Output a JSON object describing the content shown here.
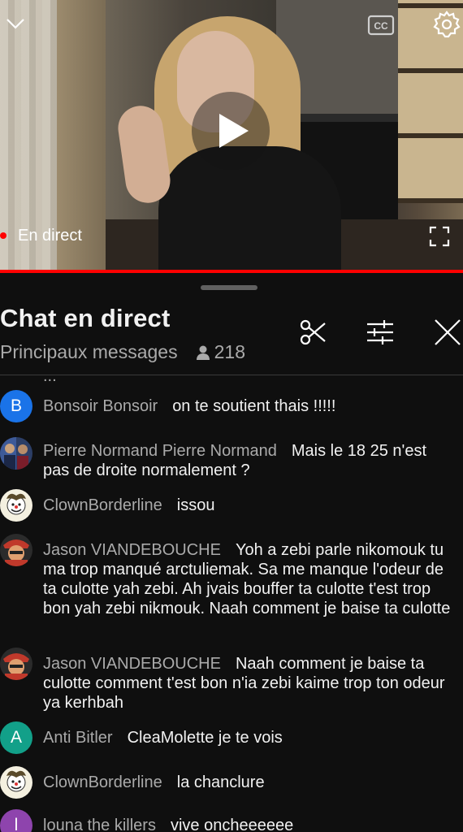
{
  "player": {
    "live_label": "En direct",
    "progress_color": "#ff0000",
    "icons": [
      "chevron-down-icon",
      "closed-captions-icon",
      "settings-gear-icon",
      "play-icon",
      "fullscreen-icon"
    ]
  },
  "chat": {
    "title": "Chat en direct",
    "mode": "Principaux messages",
    "viewer_count": "218",
    "icons": [
      "scissors-icon",
      "filter-sliders-icon",
      "close-icon"
    ],
    "partial_top_text": "..."
  },
  "messages": [
    {
      "author": "Bonsoir Bonsoir",
      "text": "on te soutient thais !!!!!",
      "avatar_letter": "B",
      "avatar_color": "#1a73e8"
    },
    {
      "author": "Pierre Normand Pierre Normand",
      "text": "Mais le 18 25 n'est pas de droite normalement ?",
      "avatar_letter": "",
      "avatar_color": "#3b4a7a"
    },
    {
      "author": "ClownBorderline",
      "text": "issou",
      "avatar_letter": "",
      "avatar_color": "#e8e4d0"
    },
    {
      "author": "Jason VIANDEBOUCHE",
      "text": "Yoh a zebi parle nikomouk tu ma trop manqué arctuliemak. Sa me manque l'odeur de ta culotte yah zebi. Ah jvais bouffer ta culotte t'est trop bon yah zebi nikmouk. Naah comment je baise ta culotte",
      "avatar_letter": "",
      "avatar_color": "#c0392b"
    },
    {
      "author": "Jason VIANDEBOUCHE",
      "text": "Naah comment je baise ta culotte comment t'est bon n'ia zebi kaime trop ton odeur ya kerhbah",
      "avatar_letter": "",
      "avatar_color": "#c0392b"
    },
    {
      "author": "Anti Bitler",
      "text": "CleaMolette je te vois",
      "avatar_letter": "A",
      "avatar_color": "#12a089"
    },
    {
      "author": "ClownBorderline",
      "text": "la chanclure",
      "avatar_letter": "",
      "avatar_color": "#e8e4d0"
    },
    {
      "author": "louna the killers",
      "text": "vive oncheeeeee",
      "avatar_letter": "l",
      "avatar_color": "#8e44ad"
    }
  ]
}
